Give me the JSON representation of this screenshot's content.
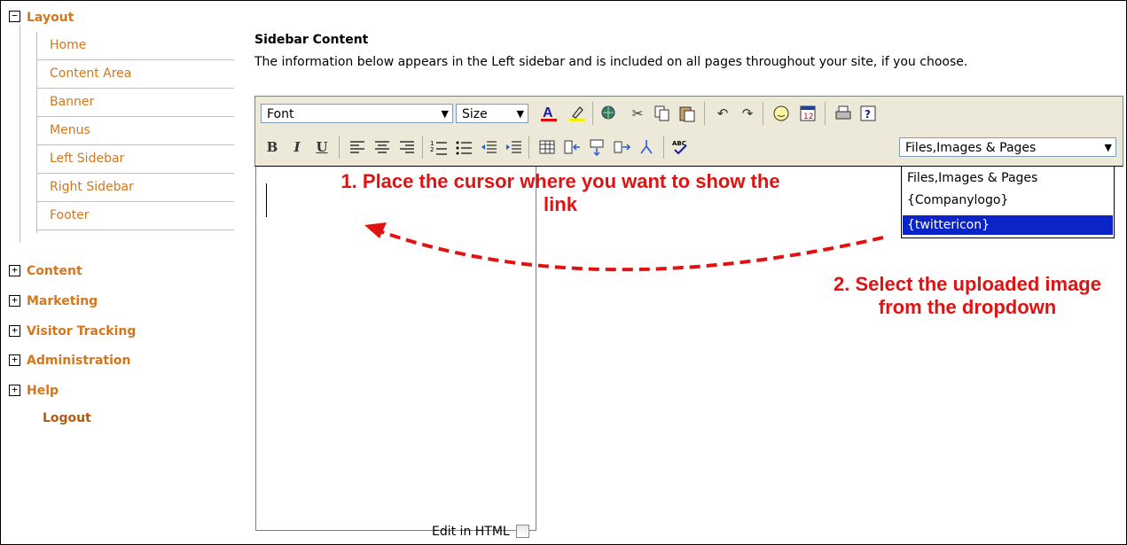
{
  "nav": {
    "layout": {
      "label": "Layout",
      "toggle": "−",
      "items": [
        "Home",
        "Content Area",
        "Banner",
        "Menus",
        "Left Sidebar",
        "Right Sidebar",
        "Footer"
      ]
    },
    "sections": [
      {
        "label": "Content",
        "toggle": "+"
      },
      {
        "label": "Marketing",
        "toggle": "+"
      },
      {
        "label": "Visitor Tracking",
        "toggle": "+"
      },
      {
        "label": "Administration",
        "toggle": "+"
      },
      {
        "label": "Help",
        "toggle": "+"
      }
    ],
    "logout": "Logout"
  },
  "main": {
    "title": "Sidebar Content",
    "description": "The information below appears in the Left sidebar and is included on all pages throughout your site, if you choose.",
    "toolbar": {
      "font_select": "Font",
      "size_select": "Size",
      "bold": "B",
      "italic": "I",
      "underline": "U",
      "link_select": "Files,Images & Pages"
    },
    "dropdown_options": [
      "Files,Images & Pages",
      "{Companylogo}",
      "{twittericon}"
    ],
    "selected_option": "{twittericon}",
    "edit_in_html_label": "Edit in HTML",
    "edit_in_html_checked": false
  },
  "annotations": {
    "step1": "1. Place the cursor where you want to show the link",
    "step2": "2. Select the uploaded image from the dropdown"
  },
  "colors": {
    "nav_accent": "#d4761c",
    "annotation": "#e01212",
    "selection": "#0a24c8"
  }
}
